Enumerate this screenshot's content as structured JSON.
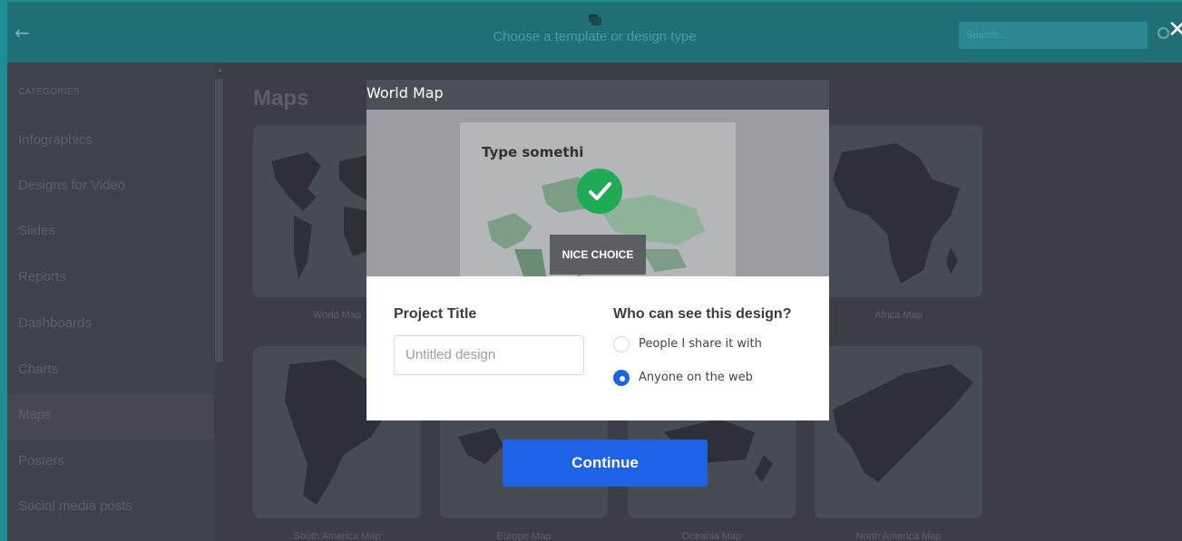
{
  "header": {
    "back_icon": "arrow-left-icon",
    "title": "Choose a template or design type",
    "search_placeholder": "Search...",
    "close_icon": "close-icon"
  },
  "sidebar": {
    "heading": "CATEGORIES",
    "items": [
      {
        "label": "Infographics",
        "active": false
      },
      {
        "label": "Designs for Video",
        "active": false
      },
      {
        "label": "Slides",
        "active": false
      },
      {
        "label": "Reports",
        "active": false
      },
      {
        "label": "Dashboards",
        "active": false
      },
      {
        "label": "Charts",
        "active": false
      },
      {
        "label": "Maps",
        "active": true
      },
      {
        "label": "Posters",
        "active": false
      },
      {
        "label": "Social media posts",
        "active": false
      }
    ]
  },
  "main": {
    "title": "Maps",
    "cards": [
      {
        "label": "World Map"
      },
      {
        "label": "Africa Map"
      },
      {
        "label": "South America Map"
      },
      {
        "label": "Europe Map"
      },
      {
        "label": "Oceania Map"
      },
      {
        "label": "North America Map"
      }
    ]
  },
  "modal": {
    "title": "World Map",
    "preview_text": "Type somethi",
    "badge": "NICE CHOICE",
    "project_title_label": "Project Title",
    "project_title_placeholder": "Untitled design",
    "visibility_label": "Who can see this design?",
    "options": [
      {
        "label": "People I share it with",
        "selected": false
      },
      {
        "label": "Anyone on the web",
        "selected": true
      }
    ],
    "continue_label": "Continue"
  },
  "colors": {
    "header_bg": "#1f6f77",
    "accent_blue": "#1e62e8",
    "check_green": "#1faa55"
  }
}
